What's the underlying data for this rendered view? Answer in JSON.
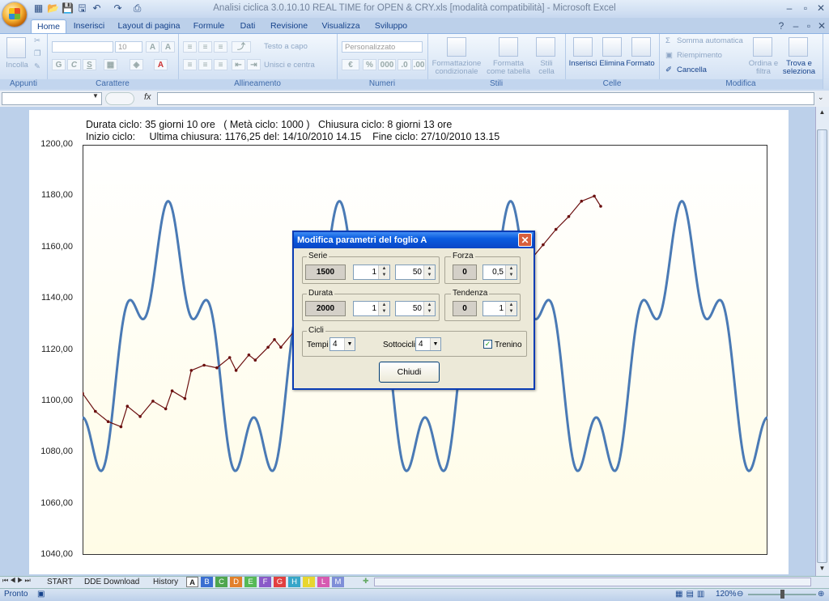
{
  "window": {
    "title": "Analisi ciclica 3.0.10.10 REAL TIME for OPEN & CRY.xls  [modalità compatibilità] - Microsoft Excel"
  },
  "ribbon": {
    "tabs": [
      "Home",
      "Inserisci",
      "Layout di pagina",
      "Formule",
      "Dati",
      "Revisione",
      "Visualizza",
      "Sviluppo"
    ],
    "groups": {
      "appunti": {
        "label": "Appunti",
        "incolla": "Incolla"
      },
      "carattere": {
        "label": "Carattere",
        "font_size": "10",
        "bold": "G",
        "italic": "C",
        "underline": "S"
      },
      "allineamento": {
        "label": "Allineamento",
        "testo_a_capo": "Testo a capo",
        "unisci": "Unisci e centra"
      },
      "numeri": {
        "label": "Numeri",
        "format": "Personalizzato",
        "percent": "%",
        "thousands": "000"
      },
      "stili": {
        "label": "Stili",
        "cond": "Formattazione condizionale",
        "table": "Formatta come tabella",
        "cell": "Stili cella"
      },
      "celle": {
        "label": "Celle",
        "insert": "Inserisci",
        "delete": "Elimina",
        "format": "Formato"
      },
      "modifica": {
        "label": "Modifica",
        "sum": "Somma automatica",
        "fill": "Riempimento",
        "clear": "Cancella",
        "sort": "Ordina e filtra",
        "find": "Trova e seleziona"
      }
    }
  },
  "formula_bar": {
    "fx": "fx"
  },
  "chart_header": {
    "line1": "Durata ciclo: 35 giorni 10 ore   ( Metà ciclo: 1000 )   Chiusura ciclo: 8 giorni 13 ore",
    "line2": "Inizio ciclo:     Ultima chiusura: 1176,25 del: 14/10/2010 14.15    Fine ciclo: 27/10/2010 13.15"
  },
  "chart_data": {
    "type": "line",
    "ylim": [
      1040,
      1200
    ],
    "yticks": [
      "1200,00",
      "1180,00",
      "1160,00",
      "1140,00",
      "1120,00",
      "1100,00",
      "1080,00",
      "1060,00",
      "1040,00"
    ],
    "series": [
      {
        "name": "",
        "color": "#4a7ab5",
        "kind": "cycle",
        "mean": 1120,
        "amplitude": 58
      },
      {
        "name": "",
        "color": "#6b0f0f",
        "kind": "price",
        "points": [
          [
            0,
            1103
          ],
          [
            2,
            1096
          ],
          [
            4,
            1092
          ],
          [
            6,
            1090
          ],
          [
            7,
            1098
          ],
          [
            9,
            1094
          ],
          [
            11,
            1100
          ],
          [
            13,
            1097
          ],
          [
            14,
            1104
          ],
          [
            16,
            1101
          ],
          [
            17,
            1112
          ],
          [
            19,
            1114
          ],
          [
            21,
            1113
          ],
          [
            23,
            1117
          ],
          [
            24,
            1112
          ],
          [
            26,
            1118
          ],
          [
            27,
            1116
          ],
          [
            29,
            1121
          ],
          [
            30,
            1124
          ],
          [
            31,
            1121
          ],
          [
            33,
            1127
          ],
          [
            35,
            1130
          ],
          [
            37,
            1129
          ],
          [
            39,
            1136
          ],
          [
            41,
            1138
          ],
          [
            43,
            1143
          ],
          [
            45,
            1140
          ],
          [
            47,
            1141
          ],
          [
            49,
            1140
          ],
          [
            51,
            1142
          ],
          [
            53,
            1144
          ],
          [
            55,
            1141
          ],
          [
            57,
            1146
          ],
          [
            59,
            1150
          ],
          [
            61,
            1152
          ],
          [
            63,
            1154
          ],
          [
            65,
            1158
          ],
          [
            67,
            1163
          ],
          [
            68,
            1159
          ],
          [
            69,
            1153
          ],
          [
            70,
            1155
          ],
          [
            72,
            1161
          ],
          [
            74,
            1167
          ],
          [
            76,
            1172
          ],
          [
            78,
            1178
          ],
          [
            80,
            1180
          ],
          [
            81,
            1176
          ]
        ]
      }
    ]
  },
  "dialog": {
    "title": "Modifica parametri del foglio A",
    "serie": {
      "label": "Serie",
      "value": "1500",
      "spin1": "1",
      "spin2": "50"
    },
    "forza": {
      "label": "Forza",
      "value": "0",
      "spin": "0,5"
    },
    "durata": {
      "label": "Durata",
      "value": "2000",
      "spin1": "1",
      "spin2": "50"
    },
    "tendenza": {
      "label": "Tendenza",
      "value": "0",
      "spin": "1"
    },
    "cicli": {
      "label": "Cicli",
      "tempi_label": "Tempi",
      "tempi": "4",
      "sottocicli_label": "Sottocicli",
      "sottocicli": "4",
      "trenino_label": "Trenino",
      "trenino_checked": true
    },
    "close_label": "Chiudi"
  },
  "sheet_tabs": {
    "named": [
      "START",
      "DDE Download",
      "History"
    ],
    "letters": [
      "A",
      "B",
      "C",
      "D",
      "E",
      "F",
      "G",
      "H",
      "I",
      "L",
      "M"
    ],
    "letter_colors": [
      "#ffffff",
      "#3b6fd1",
      "#4fa64f",
      "#e2802a",
      "#56b956",
      "#8a5ac8",
      "#e24040",
      "#36a6c9",
      "#e8d630",
      "#d65ab1",
      "#7f8fd8"
    ],
    "active": "A"
  },
  "status_bar": {
    "ready": "Pronto",
    "zoom": "120%"
  }
}
